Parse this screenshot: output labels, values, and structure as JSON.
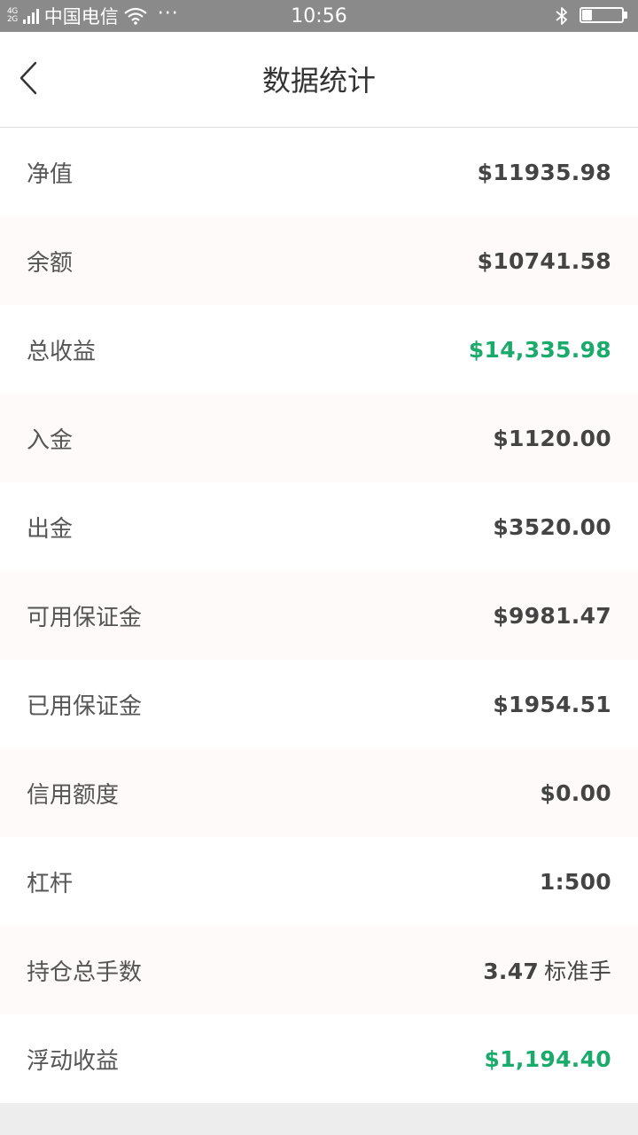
{
  "status_bar": {
    "network_top": "4G",
    "network_bottom": "2G",
    "carrier": "中国电信",
    "more": "···",
    "time": "10:56",
    "battery_level_fraction": 0.25,
    "icons": [
      "signal-icon",
      "wifi-icon",
      "bluetooth-icon",
      "battery-icon"
    ]
  },
  "nav": {
    "back_icon": "chevron-left-icon",
    "title": "数据统计"
  },
  "colors": {
    "positive": "#1aaa6c",
    "value": "#444444",
    "label": "#555555",
    "row_alt": "#fefaf9",
    "status_bar": "#8a8a8a"
  },
  "stats": [
    {
      "label": "净值",
      "value": "$11935.98",
      "positive": false
    },
    {
      "label": "余额",
      "value": "$10741.58",
      "positive": false
    },
    {
      "label": "总收益",
      "value": "$14,335.98",
      "positive": true
    },
    {
      "label": "入金",
      "value": "$1120.00",
      "positive": false
    },
    {
      "label": "出金",
      "value": "$3520.00",
      "positive": false
    },
    {
      "label": "可用保证金",
      "value": "$9981.47",
      "positive": false
    },
    {
      "label": "已用保证金",
      "value": "$1954.51",
      "positive": false
    },
    {
      "label": "信用额度",
      "value": "$0.00",
      "positive": false
    },
    {
      "label": "杠杆",
      "value": "1:500",
      "positive": false
    },
    {
      "label": "持仓总手数",
      "value": "3.47",
      "unit": "标准手",
      "positive": false
    },
    {
      "label": "浮动收益",
      "value": "$1,194.40",
      "positive": true
    }
  ]
}
